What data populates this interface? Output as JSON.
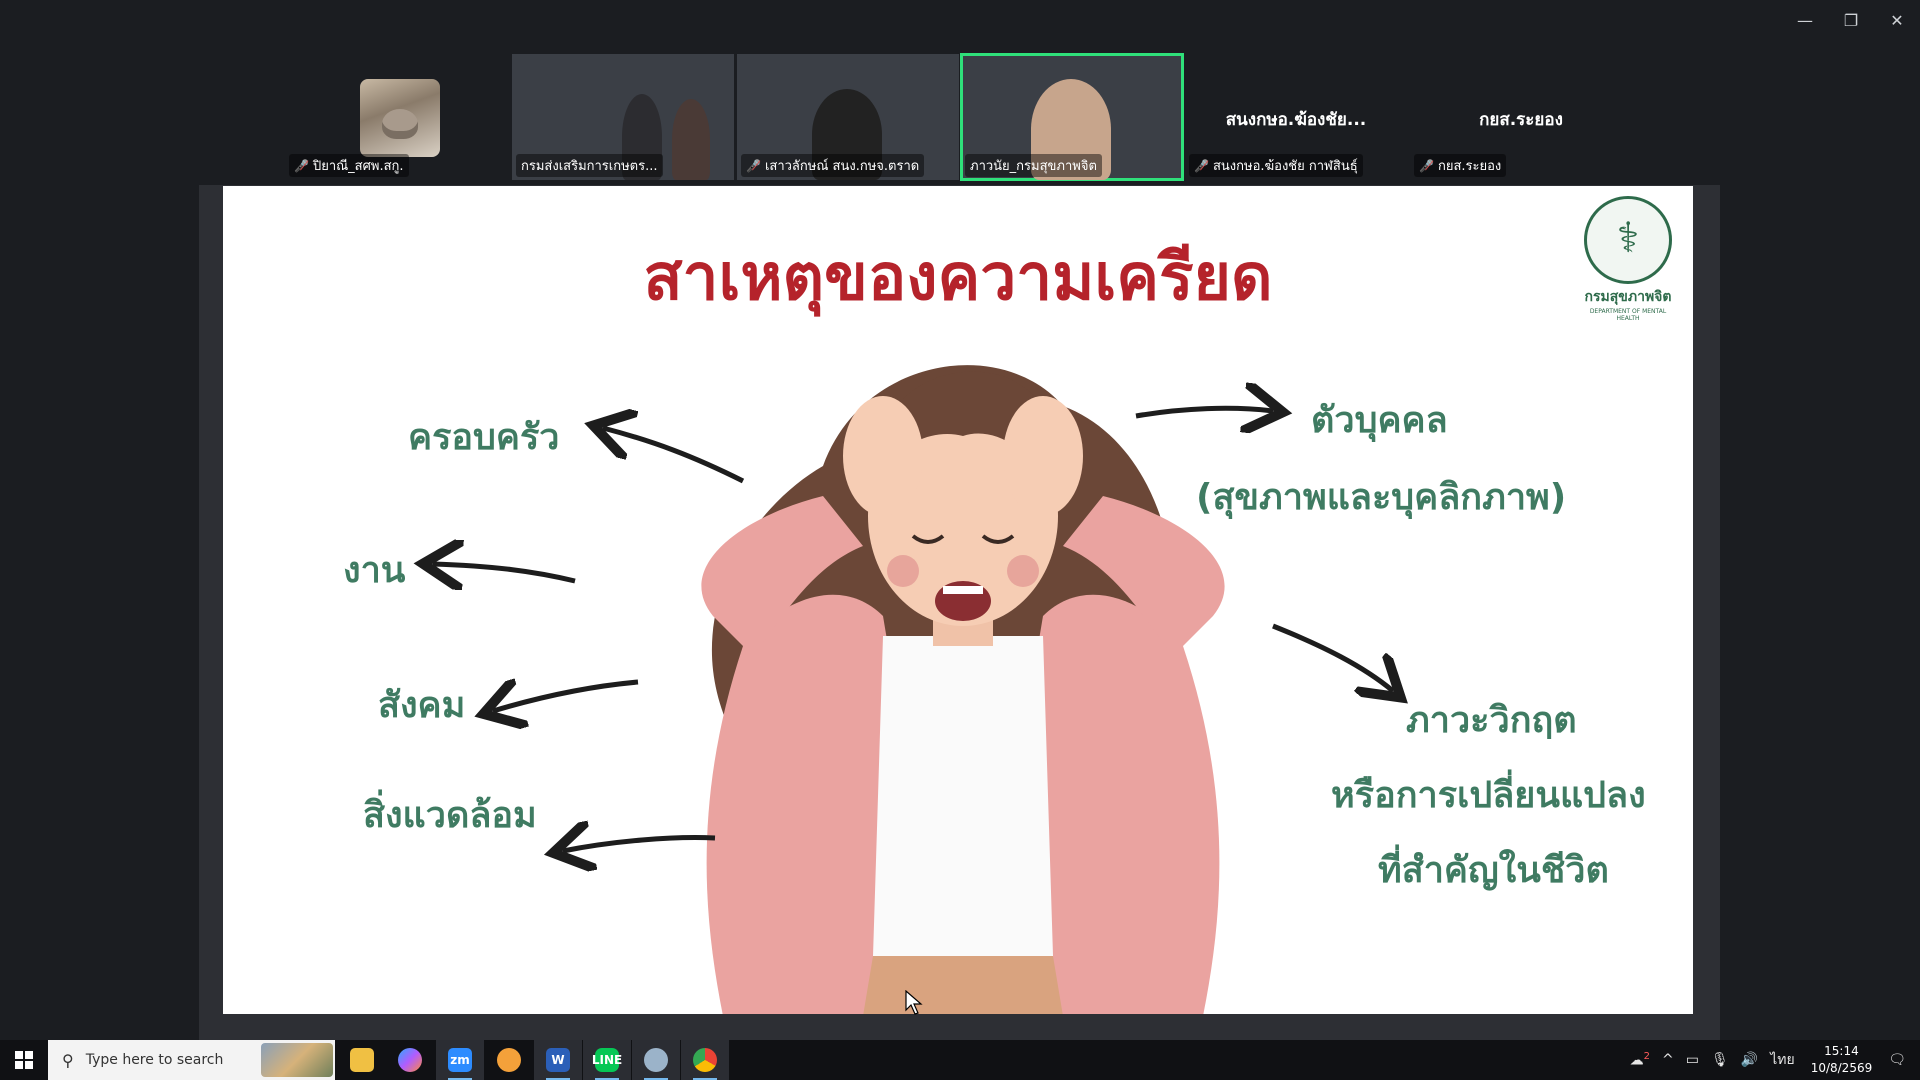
{
  "window": {
    "minimize": "—",
    "restore": "❐",
    "close": "✕"
  },
  "participants": [
    {
      "name": "ปิยาณี_สศพ.สกู.",
      "type": "avatar",
      "muted": true
    },
    {
      "name": "กรมส่งเสริมการเกษตร...",
      "type": "video",
      "muted": false
    },
    {
      "name": "เสาวลักษณ์ สนง.กษจ.ตราด",
      "type": "video",
      "muted": true
    },
    {
      "name": "ภาวนัย_กรมสุขภาพจิต",
      "type": "video",
      "muted": false,
      "active": true
    },
    {
      "name": "สนงกษอ.ฆ้องชัย กาฬสินธุ์",
      "label": "สนงกษอ.ฆ้องชัย...",
      "type": "name",
      "muted": true
    },
    {
      "name": "กยส.ระยอง",
      "label": "กยส.ระยอง",
      "type": "name",
      "muted": true
    }
  ],
  "slide": {
    "title": "สาเหตุของความเครียด",
    "logo_text": "กรมสุขภาพจิต",
    "logo_subtext": "DEPARTMENT OF MENTAL HEALTH",
    "left_labels": [
      "ครอบครัว",
      "งาน",
      "สังคม",
      "สิ่งแวดล้อม"
    ],
    "right_top": [
      "ตัวบุคคล",
      "(สุขภาพและบุคลิกภาพ)"
    ],
    "right_bottom": [
      "ภาวะวิกฤต",
      "หรือการเปลี่ยนแปลง",
      "ที่สำคัญในชีวิต"
    ],
    "accent_color": "#3f7b62",
    "title_color": "#b5232b"
  },
  "taskbar": {
    "search_placeholder": "Type here to search",
    "apps": [
      "file-explorer",
      "copilot",
      "zoom",
      "chrome-beta",
      "word",
      "line",
      "paint",
      "chrome"
    ],
    "notification_count": "2",
    "language": "ไทย",
    "time": "15:14",
    "date": "10/8/2569"
  }
}
